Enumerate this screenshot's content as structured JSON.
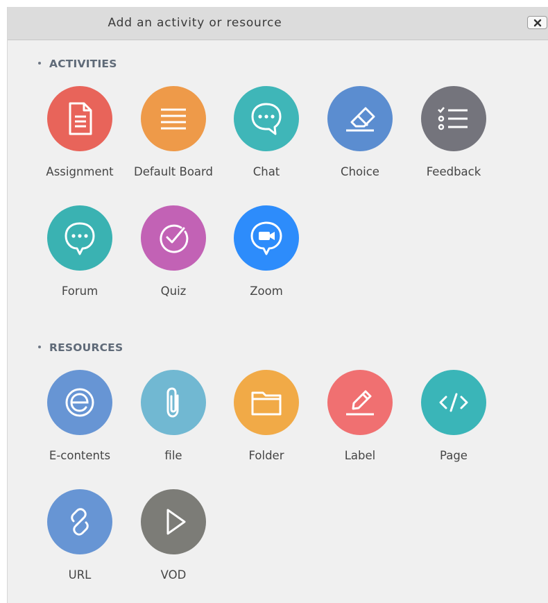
{
  "dialog": {
    "title": "Add an activity or resource",
    "close_label": "close"
  },
  "sections": {
    "activities": {
      "heading": "ACTIVITIES",
      "items": [
        {
          "label": "Assignment",
          "icon": "document-icon",
          "color": "#e8645a"
        },
        {
          "label": "Default Board",
          "icon": "list-icon",
          "color": "#ee9a49"
        },
        {
          "label": "Chat",
          "icon": "speech-bubble-icon",
          "color": "#3fb6b8"
        },
        {
          "label": "Choice",
          "icon": "eraser-icon",
          "color": "#5b8dd0"
        },
        {
          "label": "Feedback",
          "icon": "checklist-icon",
          "color": "#74747c"
        },
        {
          "label": "Forum",
          "icon": "speech-bubble-icon",
          "color": "#3ab2b2"
        },
        {
          "label": "Quiz",
          "icon": "check-circle-icon",
          "color": "#c262b5"
        },
        {
          "label": "Zoom",
          "icon": "video-camera-icon",
          "color": "#2d8cfb"
        }
      ]
    },
    "resources": {
      "heading": "RESOURCES",
      "items": [
        {
          "label": "E-contents",
          "icon": "e-letter-icon",
          "color": "#6795d4"
        },
        {
          "label": "file",
          "icon": "paperclip-icon",
          "color": "#71b8d2"
        },
        {
          "label": "Folder",
          "icon": "folder-icon",
          "color": "#f1aa47"
        },
        {
          "label": "Label",
          "icon": "pencil-icon",
          "color": "#f07071"
        },
        {
          "label": "Page",
          "icon": "code-icon",
          "color": "#3ab5b8"
        },
        {
          "label": "URL",
          "icon": "link-icon",
          "color": "#6795d4"
        },
        {
          "label": "VOD",
          "icon": "play-icon",
          "color": "#7c7c77"
        }
      ]
    }
  }
}
